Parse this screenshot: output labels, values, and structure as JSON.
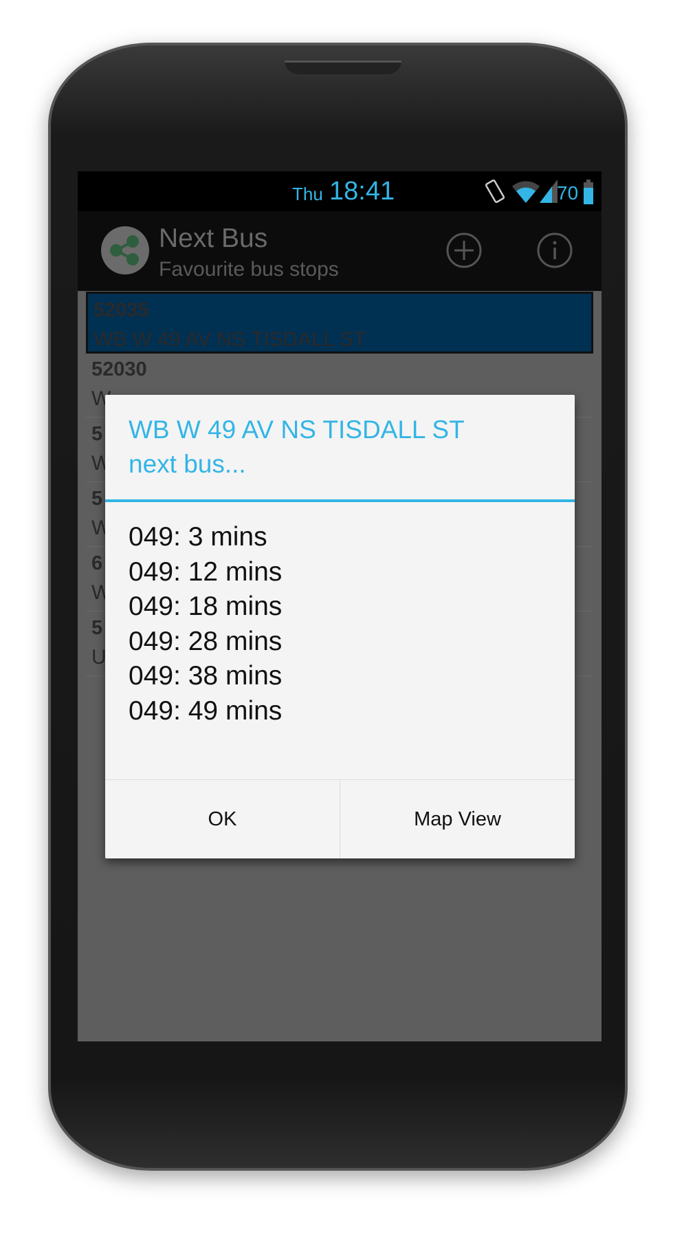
{
  "status_bar": {
    "day": "Thu",
    "time": "18:41",
    "battery": "70",
    "icons": [
      "vibrate-icon",
      "wifi-icon",
      "signal-icon",
      "battery-icon"
    ]
  },
  "action_bar": {
    "title": "Next Bus",
    "subtitle": "Favourite bus stops",
    "icons": [
      "share-icon",
      "add-icon",
      "info-icon"
    ]
  },
  "list": {
    "rows": [
      {
        "id": "52035",
        "name": "WB W 49 AV NS TISDALL ST",
        "selected": true
      },
      {
        "id": "52030",
        "name": "W"
      },
      {
        "id": "5",
        "name": "W"
      },
      {
        "id": "5",
        "name": "W"
      },
      {
        "id": "6",
        "name": "W"
      },
      {
        "id": "5",
        "name": "U"
      }
    ]
  },
  "dialog": {
    "title_line1": "WB W 49 AV NS TISDALL ST",
    "title_line2": "next bus...",
    "times": [
      "049: 3 mins",
      "049: 12 mins",
      "049: 18 mins",
      "049: 28 mins",
      "049: 38 mins",
      "049: 49 mins"
    ],
    "ok_label": "OK",
    "map_label": "Map View"
  },
  "colors": {
    "accent": "#33b5e5",
    "selected": "#003052",
    "dim": "#5e5e5e"
  }
}
